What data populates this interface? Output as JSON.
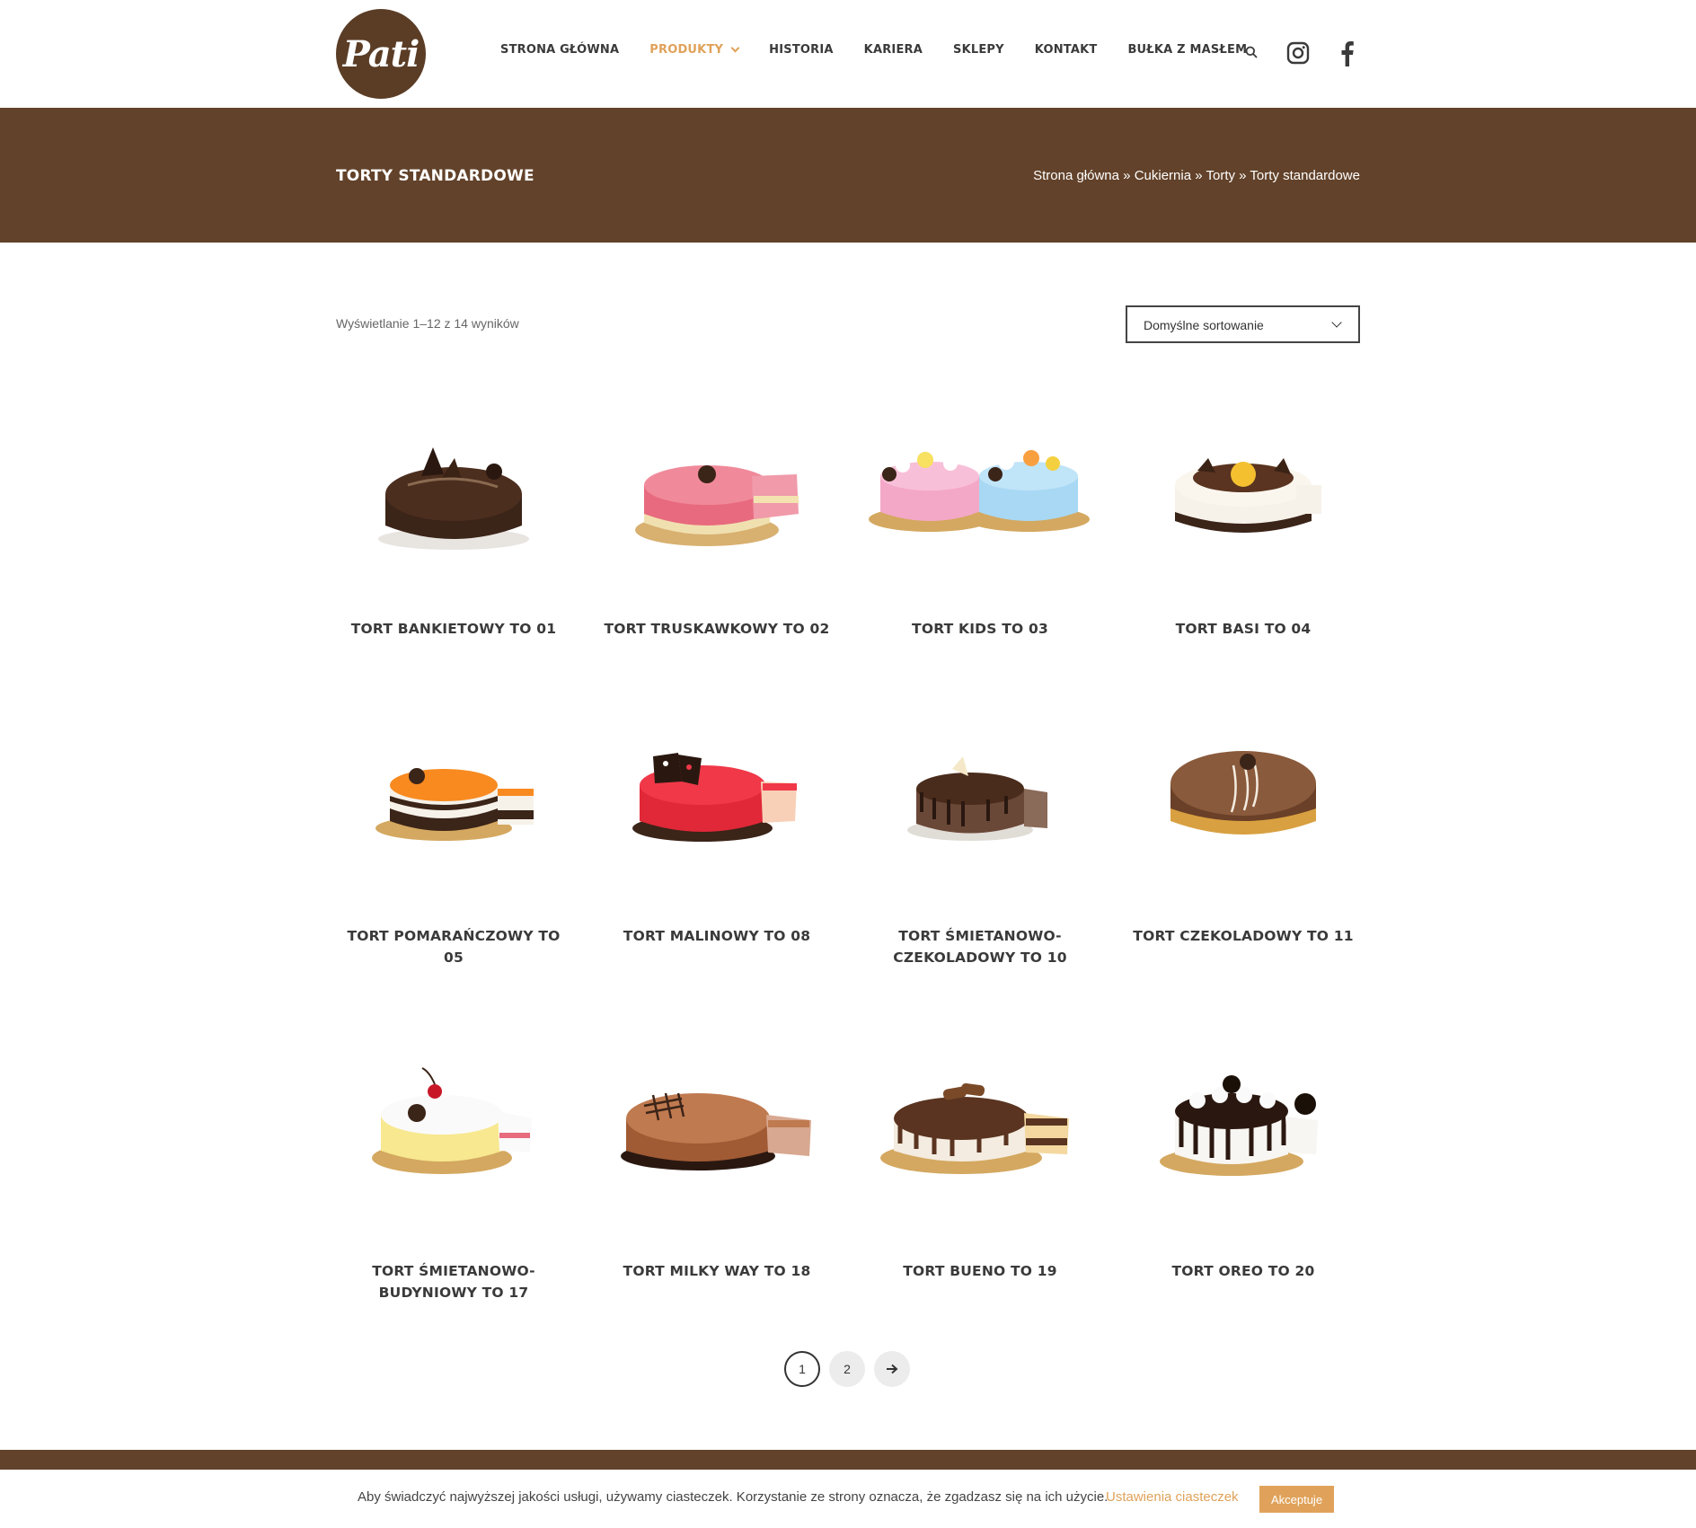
{
  "brand": {
    "logo_text": "Pati"
  },
  "nav": {
    "items": [
      {
        "label": "STRONA GŁÓWNA",
        "active": false
      },
      {
        "label": "PRODUKTY",
        "active": true
      },
      {
        "label": "HISTORIA",
        "active": false
      },
      {
        "label": "KARIERA",
        "active": false
      },
      {
        "label": "SKLEPY",
        "active": false
      },
      {
        "label": "KONTAKT",
        "active": false
      },
      {
        "label": "BUŁKA Z MASŁEM",
        "active": false
      }
    ],
    "icons": [
      "search-icon",
      "instagram-icon",
      "facebook-icon"
    ]
  },
  "title_bar": {
    "title": "TORTY STANDARDOWE",
    "breadcrumb": [
      "Strona główna",
      "Cukiernia",
      "Torty",
      "Torty standardowe"
    ],
    "separator": "»"
  },
  "toolbar": {
    "result_count": "Wyświetlanie 1–12 z 14 wyników",
    "sort_value": "Domyślne sortowanie"
  },
  "products": [
    {
      "line1": "TORT BANKIETOWY TO 01",
      "line2": ""
    },
    {
      "line1": "TORT TRUSKAWKOWY TO 02",
      "line2": ""
    },
    {
      "line1": "TORT KIDS TO 03",
      "line2": ""
    },
    {
      "line1": "TORT BASI TO 04",
      "line2": ""
    },
    {
      "line1": "TORT POMARAŃCZOWY TO 05",
      "line2": ""
    },
    {
      "line1": "TORT MALINOWY TO 08",
      "line2": ""
    },
    {
      "line1": "TORT ŚMIETANOWO-",
      "line2": "CZEKOLADOWY TO 10"
    },
    {
      "line1": "TORT CZEKOLADOWY TO 11",
      "line2": ""
    },
    {
      "line1": "TORT ŚMIETANOWO-",
      "line2": "BUDYNIOWY TO 17"
    },
    {
      "line1": "TORT MILKY WAY TO 18",
      "line2": ""
    },
    {
      "line1": "TORT BUENO TO 19",
      "line2": ""
    },
    {
      "line1": "TORT OREO TO 20",
      "line2": ""
    }
  ],
  "pagination": {
    "pages": [
      "1",
      "2"
    ],
    "current": "1",
    "next_icon": "arrow-right-icon"
  },
  "cookie": {
    "text": "Aby świadczyć najwyższej jakości usługi, używamy ciasteczek. Korzystanie ze strony oznacza, że zgadzasz się na ich użycie.",
    "settings_link": "Ustawienia ciasteczek",
    "accept_label": "Akceptuje"
  },
  "colors": {
    "brand_brown": "#62422a",
    "accent": "#e0a25a"
  }
}
